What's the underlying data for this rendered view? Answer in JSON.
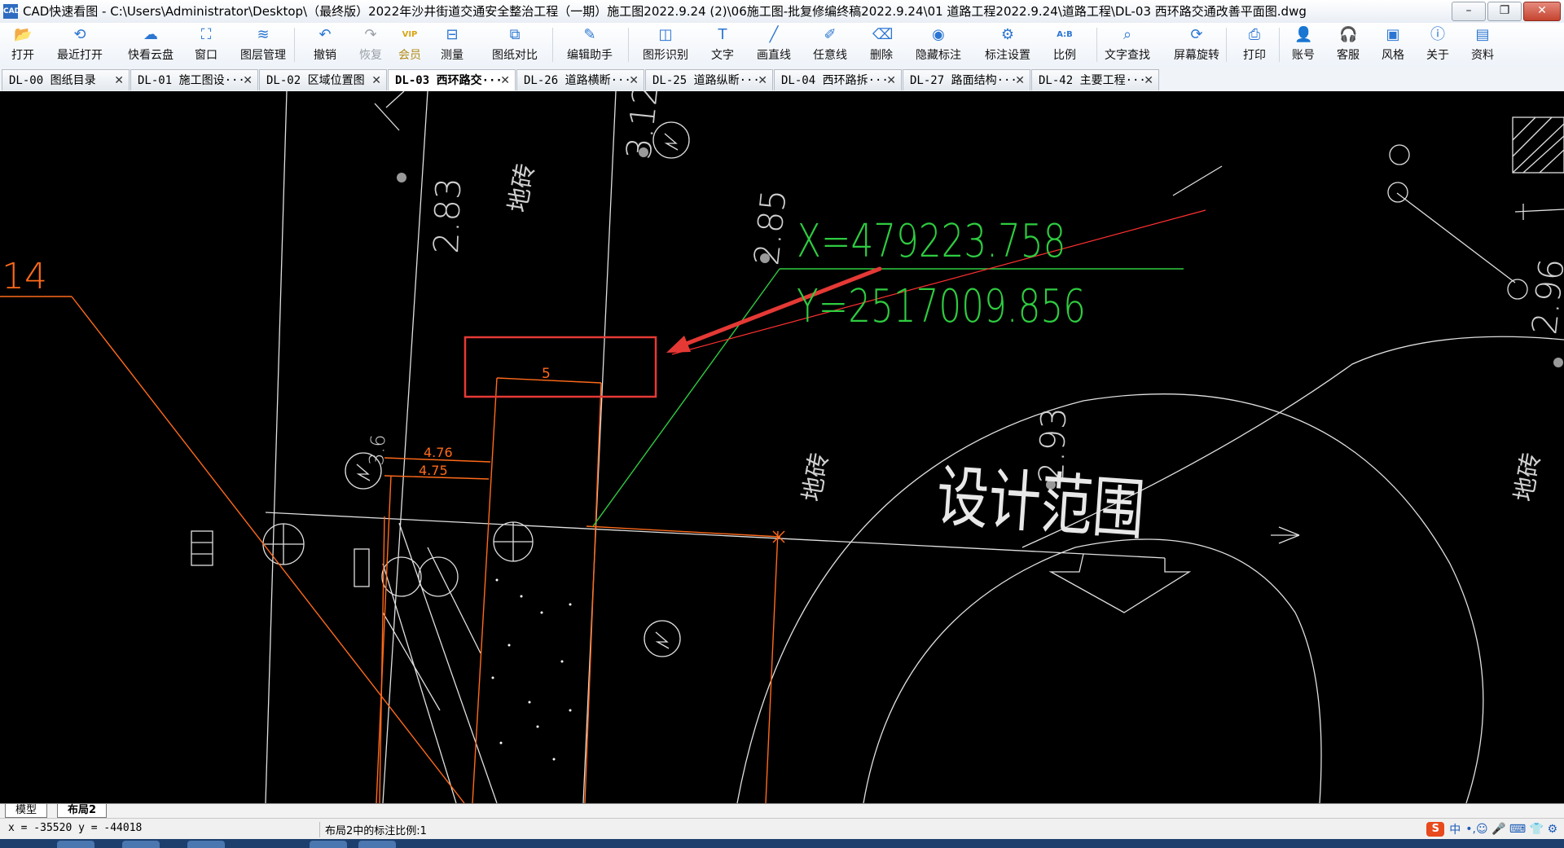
{
  "window": {
    "app_icon_text": "CAD",
    "title": "CAD快速看图 - C:\\Users\\Administrator\\Desktop\\（最终版）2022年沙井街道交通安全整治工程（一期）施工图2022.9.24 (2)\\06施工图-批复修编终稿2022.9.24\\01 道路工程2022.9.24\\道路工程\\DL-03 西环路交通改善平面图.dwg",
    "minimize": "–",
    "restore": "❐",
    "close": "✕"
  },
  "toolbar": [
    {
      "label": "打开",
      "icon": "folder-icon",
      "glyph": "📂"
    },
    {
      "label": "最近打开",
      "icon": "clock-icon",
      "glyph": "⟲"
    },
    {
      "label": "快看云盘",
      "icon": "cloud-icon",
      "glyph": "☁"
    },
    {
      "label": "窗口",
      "icon": "window-icon",
      "glyph": "⛶"
    },
    {
      "label": "图层管理",
      "icon": "layers-icon",
      "glyph": "≋"
    },
    {
      "label": "撤销",
      "icon": "undo-icon",
      "glyph": "↶"
    },
    {
      "label": "恢复",
      "icon": "redo-icon",
      "glyph": "↷",
      "disabled": true
    },
    {
      "label": "会员",
      "icon": "vip-icon",
      "glyph": "VIP",
      "vip": true
    },
    {
      "label": "测量",
      "icon": "ruler-icon",
      "glyph": "⊟"
    },
    {
      "label": "图纸对比",
      "icon": "compare-icon",
      "glyph": "⧉"
    },
    {
      "label": "编辑助手",
      "icon": "edit-assistant-icon",
      "glyph": "✎"
    },
    {
      "label": "图形识别",
      "icon": "shape-recognize-icon",
      "glyph": "◫"
    },
    {
      "label": "文字",
      "icon": "text-icon",
      "glyph": "T"
    },
    {
      "label": "画直线",
      "icon": "line-icon",
      "glyph": "╱"
    },
    {
      "label": "任意线",
      "icon": "pen-icon",
      "glyph": "✐"
    },
    {
      "label": "删除",
      "icon": "eraser-icon",
      "glyph": "⌫"
    },
    {
      "label": "隐藏标注",
      "icon": "eye-hide-icon",
      "glyph": "◉"
    },
    {
      "label": "标注设置",
      "icon": "annotation-settings-icon",
      "glyph": "⚙"
    },
    {
      "label": "比例",
      "icon": "scale-icon",
      "glyph": "A:B"
    },
    {
      "label": "文字查找",
      "icon": "text-search-icon",
      "glyph": "⌕"
    },
    {
      "label": "屏幕旋转",
      "icon": "rotate-icon",
      "glyph": "⟳"
    },
    {
      "label": "打印",
      "icon": "print-icon",
      "glyph": "⎙"
    },
    {
      "label": "账号",
      "icon": "user-icon",
      "glyph": "👤"
    },
    {
      "label": "客服",
      "icon": "headset-icon",
      "glyph": "🎧"
    },
    {
      "label": "风格",
      "icon": "style-icon",
      "glyph": "▣"
    },
    {
      "label": "关于",
      "icon": "info-icon",
      "glyph": "ⓘ"
    },
    {
      "label": "资料",
      "icon": "docs-icon",
      "glyph": "▤"
    }
  ],
  "tabs": [
    {
      "label": "DL-00 图纸目录"
    },
    {
      "label": "DL-01 施工图设···"
    },
    {
      "label": "DL-02 区域位置图"
    },
    {
      "label": "DL-03 西环路交···",
      "active": true
    },
    {
      "label": "DL-26 道路横断···"
    },
    {
      "label": "DL-25 道路纵断···"
    },
    {
      "label": "DL-04 西环路拆···"
    },
    {
      "label": "DL-27 路面结构···"
    },
    {
      "label": "DL-42 主要工程···"
    }
  ],
  "tab_close": "✕",
  "drawing": {
    "coord_x": "X=479223.758",
    "coord_y": "Y=2517009.856",
    "dim_5": "5",
    "dim_476": "4.76",
    "dim_475": "4.75",
    "label_14": "14",
    "elev_283": "2.83",
    "elev_285": "2.85",
    "elev_312": "3.12",
    "elev_293": "2.93",
    "elev_296": "2.96",
    "elev_left": "3.6",
    "brick_1": "地砖",
    "brick_2": "地砖",
    "brick_3": "地砖",
    "design_range": "设计范围",
    "colors": {
      "green": "#2ecc40",
      "red": "#ff3030",
      "orange": "#ff6a1a",
      "white": "#e8e8e8",
      "highlight": "#e53935"
    }
  },
  "layout_tabs": [
    {
      "label": "模型"
    },
    {
      "label": "布局2",
      "active": true
    }
  ],
  "status": {
    "coords": "x = -35520  y = -44018",
    "scale": "布局2中的标注比例:1",
    "ime_logo": "S",
    "ime_lang": "中",
    "ime_icons": "•,☺ 🎤 ⌨ 👕 ⚙"
  }
}
